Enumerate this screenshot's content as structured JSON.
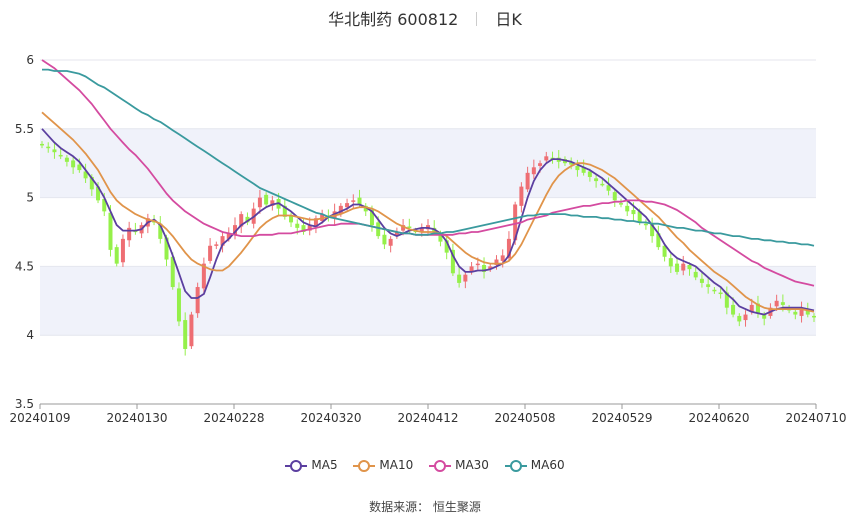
{
  "header": {
    "stock": "华北制药 600812",
    "period": "日K"
  },
  "footer": {
    "source_label": "数据来源：",
    "source_name": "恒生聚源"
  },
  "colors": {
    "up": "#ee6e73",
    "down": "#95f04a",
    "ma5": "#5b3fa0",
    "ma10": "#e0944a",
    "ma30": "#d44ba0",
    "ma60": "#3a9a9e",
    "band": "#f0f2fa",
    "grid": "#e4e6ee"
  },
  "chart_data": {
    "type": "candlestick",
    "ylim": [
      3.5,
      6
    ],
    "yticks": [
      "3.5",
      "4",
      "4.5",
      "5",
      "5.5",
      "6"
    ],
    "xticks": [
      "20240109",
      "20240130",
      "20240228",
      "20240320",
      "20240412",
      "20240508",
      "20240529",
      "20240620",
      "20240710"
    ],
    "legend": [
      "MA5",
      "MA10",
      "MA30",
      "MA60"
    ],
    "closes": [
      5.38,
      5.36,
      5.33,
      5.3,
      5.26,
      5.22,
      5.2,
      5.14,
      5.06,
      4.98,
      4.9,
      4.62,
      4.52,
      4.7,
      4.78,
      4.75,
      4.8,
      4.85,
      4.82,
      4.7,
      4.55,
      4.35,
      4.1,
      3.9,
      4.15,
      4.35,
      4.52,
      4.65,
      4.66,
      4.72,
      4.74,
      4.8,
      4.88,
      4.82,
      4.92,
      5.0,
      4.95,
      4.98,
      4.92,
      4.86,
      4.82,
      4.78,
      4.75,
      4.8,
      4.85,
      4.88,
      4.86,
      4.9,
      4.94,
      4.96,
      4.98,
      4.95,
      4.9,
      4.8,
      4.72,
      4.66,
      4.7,
      4.75,
      4.8,
      4.78,
      4.76,
      4.78,
      4.8,
      4.75,
      4.68,
      4.6,
      4.45,
      4.38,
      4.44,
      4.5,
      4.52,
      4.46,
      4.5,
      4.55,
      4.58,
      4.7,
      4.95,
      5.08,
      5.18,
      5.22,
      5.25,
      5.3,
      5.28,
      5.26,
      5.25,
      5.24,
      5.2,
      5.18,
      5.15,
      5.12,
      5.1,
      5.05,
      4.98,
      4.95,
      4.9,
      4.88,
      4.82,
      4.8,
      4.72,
      4.64,
      4.57,
      4.5,
      4.46,
      4.52,
      4.48,
      4.42,
      4.38,
      4.35,
      4.32,
      4.3,
      4.2,
      4.15,
      4.1,
      4.15,
      4.22,
      4.16,
      4.12,
      4.2,
      4.25,
      4.22,
      4.18,
      4.15,
      4.2,
      4.15,
      4.13
    ],
    "ma5": [
      5.5,
      5.45,
      5.4,
      5.36,
      5.33,
      5.3,
      5.26,
      5.2,
      5.14,
      5.08,
      5.0,
      4.9,
      4.8,
      4.76,
      4.76,
      4.76,
      4.77,
      4.82,
      4.84,
      4.8,
      4.7,
      4.58,
      4.45,
      4.32,
      4.27,
      4.27,
      4.3,
      4.42,
      4.55,
      4.66,
      4.7,
      4.75,
      4.8,
      4.83,
      4.86,
      4.9,
      4.93,
      4.95,
      4.96,
      4.93,
      4.9,
      4.86,
      4.82,
      4.8,
      4.79,
      4.82,
      4.86,
      4.88,
      4.9,
      4.92,
      4.95,
      4.95,
      4.93,
      4.9,
      4.84,
      4.78,
      4.74,
      4.72,
      4.74,
      4.76,
      4.77,
      4.78,
      4.78,
      4.77,
      4.74,
      4.68,
      4.58,
      4.5,
      4.46,
      4.46,
      4.47,
      4.47,
      4.48,
      4.5,
      4.52,
      4.58,
      4.7,
      4.85,
      5.0,
      5.12,
      5.2,
      5.25,
      5.28,
      5.28,
      5.27,
      5.26,
      5.24,
      5.22,
      5.2,
      5.17,
      5.14,
      5.1,
      5.06,
      5.02,
      4.98,
      4.94,
      4.9,
      4.86,
      4.8,
      4.74,
      4.66,
      4.6,
      4.56,
      4.54,
      4.52,
      4.5,
      4.46,
      4.42,
      4.38,
      4.35,
      4.3,
      4.26,
      4.21,
      4.19,
      4.17,
      4.16,
      4.15,
      4.17,
      4.19,
      4.2,
      4.2,
      4.2,
      4.2,
      4.19,
      4.18
    ],
    "ma10": [
      5.62,
      5.58,
      5.54,
      5.5,
      5.46,
      5.42,
      5.37,
      5.32,
      5.26,
      5.2,
      5.12,
      5.04,
      4.98,
      4.94,
      4.91,
      4.88,
      4.86,
      4.84,
      4.83,
      4.81,
      4.77,
      4.72,
      4.66,
      4.6,
      4.55,
      4.52,
      4.5,
      4.48,
      4.47,
      4.47,
      4.5,
      4.55,
      4.6,
      4.66,
      4.72,
      4.78,
      4.82,
      4.85,
      4.87,
      4.87,
      4.87,
      4.86,
      4.85,
      4.84,
      4.84,
      4.85,
      4.86,
      4.87,
      4.88,
      4.9,
      4.92,
      4.93,
      4.93,
      4.92,
      4.9,
      4.87,
      4.84,
      4.81,
      4.79,
      4.77,
      4.76,
      4.75,
      4.75,
      4.75,
      4.74,
      4.72,
      4.68,
      4.64,
      4.6,
      4.57,
      4.55,
      4.53,
      4.52,
      4.52,
      4.52,
      4.54,
      4.59,
      4.66,
      4.75,
      4.84,
      4.93,
      5.02,
      5.1,
      5.16,
      5.2,
      5.23,
      5.25,
      5.25,
      5.24,
      5.22,
      5.2,
      5.17,
      5.14,
      5.1,
      5.06,
      5.02,
      4.98,
      4.94,
      4.9,
      4.86,
      4.81,
      4.76,
      4.71,
      4.67,
      4.62,
      4.58,
      4.54,
      4.5,
      4.46,
      4.43,
      4.4,
      4.36,
      4.32,
      4.28,
      4.25,
      4.22,
      4.2,
      4.19,
      4.19,
      4.19,
      4.19,
      4.19,
      4.19,
      4.18,
      4.17
    ],
    "ma30": [
      6.0,
      5.97,
      5.94,
      5.9,
      5.86,
      5.82,
      5.78,
      5.73,
      5.68,
      5.62,
      5.56,
      5.5,
      5.45,
      5.4,
      5.35,
      5.31,
      5.26,
      5.21,
      5.15,
      5.09,
      5.03,
      4.98,
      4.94,
      4.9,
      4.87,
      4.84,
      4.81,
      4.79,
      4.77,
      4.75,
      4.74,
      4.73,
      4.72,
      4.72,
      4.72,
      4.73,
      4.73,
      4.73,
      4.74,
      4.74,
      4.74,
      4.75,
      4.76,
      4.77,
      4.78,
      4.79,
      4.8,
      4.8,
      4.81,
      4.81,
      4.81,
      4.81,
      4.8,
      4.79,
      4.78,
      4.77,
      4.76,
      4.75,
      4.74,
      4.74,
      4.73,
      4.73,
      4.73,
      4.73,
      4.73,
      4.73,
      4.73,
      4.74,
      4.74,
      4.75,
      4.75,
      4.76,
      4.77,
      4.78,
      4.79,
      4.8,
      4.81,
      4.82,
      4.84,
      4.85,
      4.86,
      4.87,
      4.89,
      4.9,
      4.91,
      4.92,
      4.93,
      4.94,
      4.94,
      4.95,
      4.96,
      4.96,
      4.97,
      4.97,
      4.98,
      4.98,
      4.98,
      4.97,
      4.97,
      4.96,
      4.95,
      4.93,
      4.91,
      4.88,
      4.85,
      4.82,
      4.78,
      4.75,
      4.72,
      4.69,
      4.66,
      4.63,
      4.6,
      4.57,
      4.54,
      4.52,
      4.49,
      4.47,
      4.45,
      4.43,
      4.41,
      4.39,
      4.38,
      4.37,
      4.36
    ],
    "ma60": [
      5.93,
      5.93,
      5.92,
      5.92,
      5.92,
      5.91,
      5.9,
      5.88,
      5.85,
      5.82,
      5.8,
      5.77,
      5.74,
      5.71,
      5.68,
      5.65,
      5.62,
      5.6,
      5.57,
      5.55,
      5.52,
      5.49,
      5.46,
      5.43,
      5.4,
      5.37,
      5.34,
      5.31,
      5.28,
      5.25,
      5.22,
      5.19,
      5.16,
      5.13,
      5.1,
      5.07,
      5.05,
      5.03,
      5.01,
      4.99,
      4.97,
      4.95,
      4.93,
      4.91,
      4.89,
      4.88,
      4.86,
      4.85,
      4.84,
      4.83,
      4.82,
      4.81,
      4.8,
      4.79,
      4.78,
      4.77,
      4.76,
      4.75,
      4.74,
      4.74,
      4.73,
      4.73,
      4.73,
      4.74,
      4.74,
      4.75,
      4.75,
      4.76,
      4.77,
      4.78,
      4.79,
      4.8,
      4.81,
      4.82,
      4.83,
      4.84,
      4.85,
      4.86,
      4.87,
      4.87,
      4.88,
      4.88,
      4.88,
      4.88,
      4.88,
      4.87,
      4.87,
      4.86,
      4.86,
      4.86,
      4.85,
      4.85,
      4.84,
      4.84,
      4.83,
      4.83,
      4.82,
      4.82,
      4.81,
      4.81,
      4.8,
      4.79,
      4.78,
      4.78,
      4.77,
      4.76,
      4.76,
      4.75,
      4.74,
      4.74,
      4.73,
      4.72,
      4.72,
      4.71,
      4.7,
      4.7,
      4.69,
      4.69,
      4.68,
      4.68,
      4.67,
      4.67,
      4.66,
      4.66,
      4.65
    ]
  }
}
